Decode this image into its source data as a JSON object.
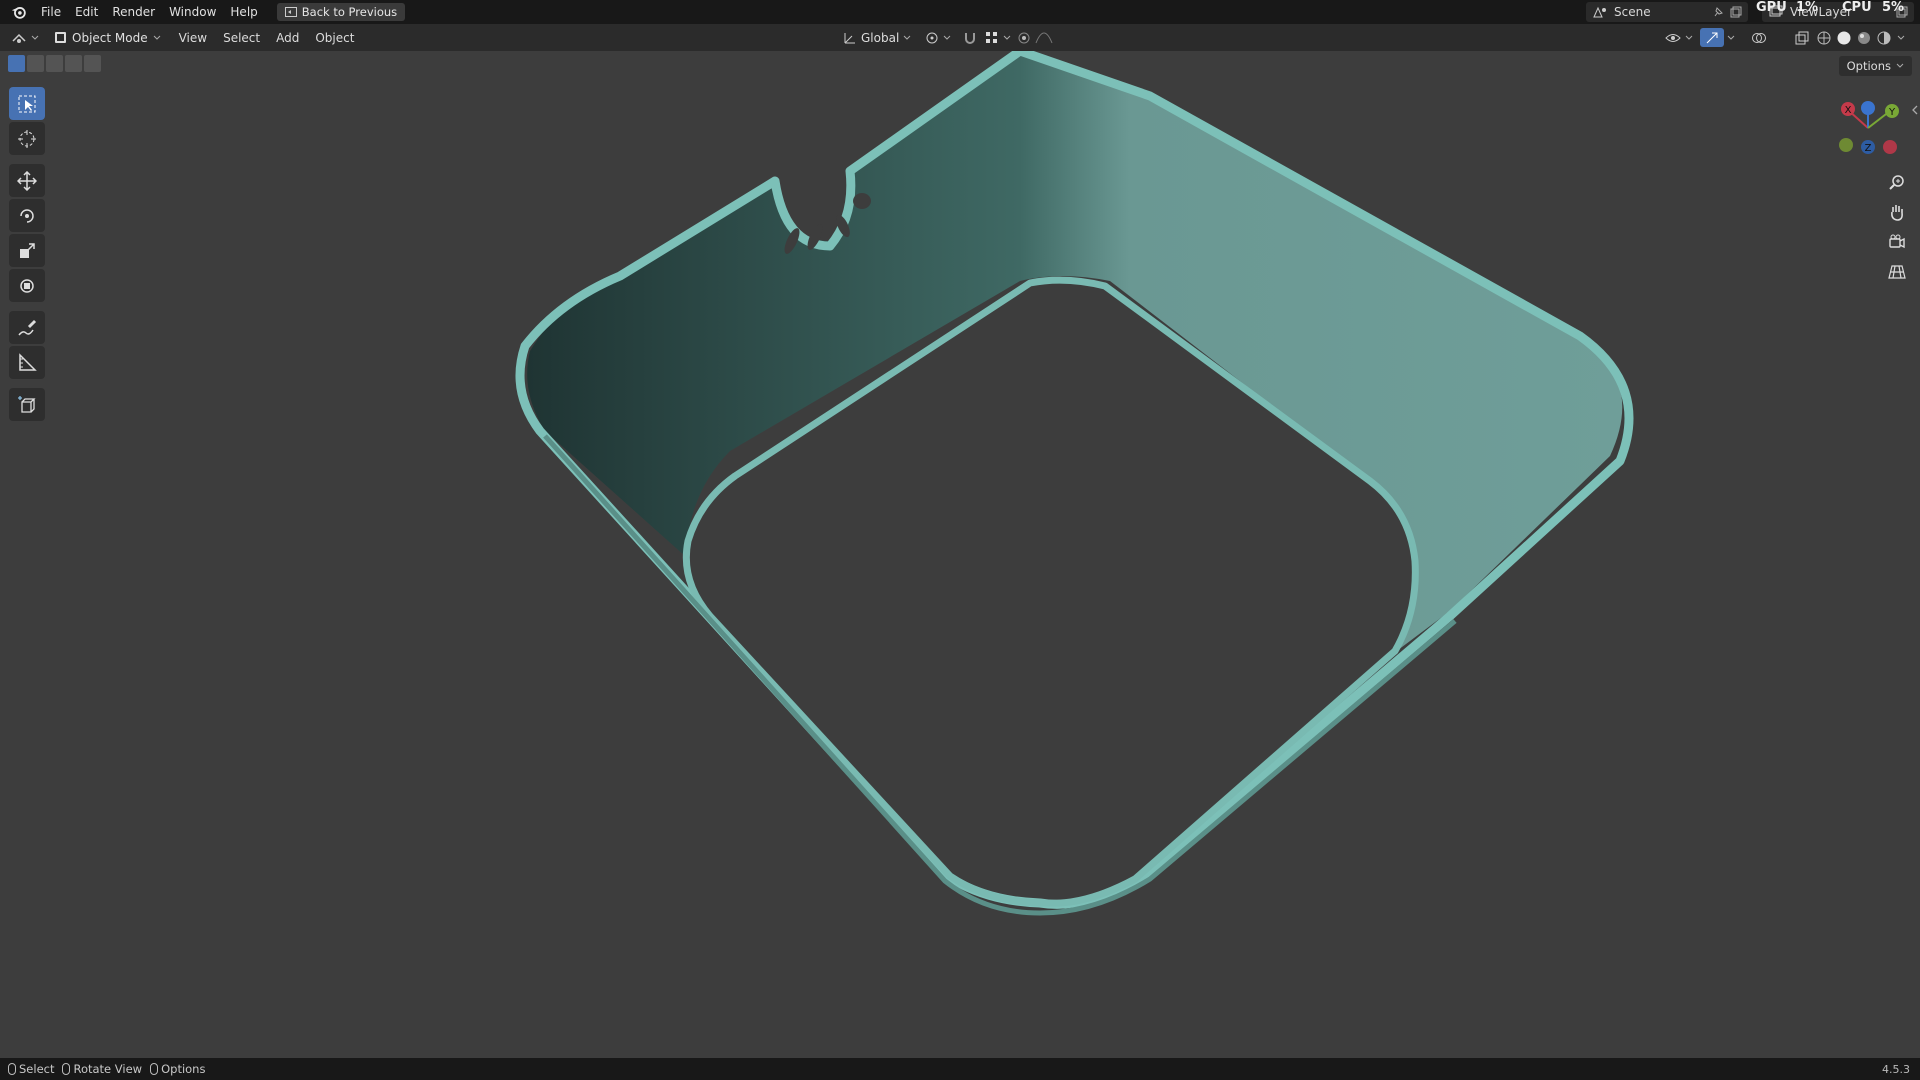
{
  "topbar": {
    "menu": [
      "File",
      "Edit",
      "Render",
      "Window",
      "Help"
    ],
    "back_label": "Back to Previous",
    "scene": "Scene",
    "view_layer": "ViewLayer",
    "gpu_label": "GPU",
    "gpu_value": "1%",
    "cpu_label": "CPU",
    "cpu_value": "5%"
  },
  "header": {
    "mode": "Object Mode",
    "menus": [
      "View",
      "Select",
      "Add",
      "Object"
    ],
    "transform_orientation": "Global"
  },
  "viewport": {
    "options_label": "Options",
    "gizmo_axes": [
      "X",
      "Y",
      "Z"
    ]
  },
  "statusbar": {
    "items": [
      "Select",
      "Rotate View",
      "Options"
    ],
    "version": "4.5.3"
  },
  "colors": {
    "model": "#6fa8a0",
    "background": "#3d3d3d",
    "active_tool": "#4772b3"
  }
}
